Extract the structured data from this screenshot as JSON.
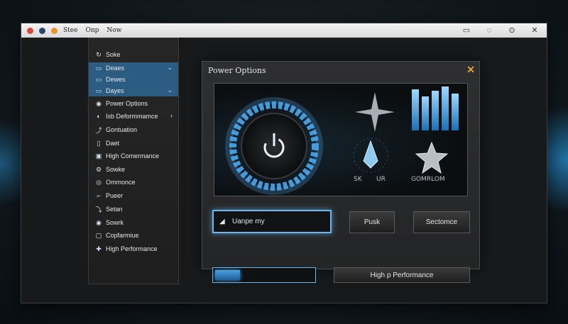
{
  "window": {
    "menu": [
      "Stee",
      "Onp",
      "Now"
    ],
    "controls": [
      "▭",
      "◌",
      "⊙",
      "✕"
    ]
  },
  "sidebar": {
    "items": [
      {
        "icon": "↻",
        "label": "Soke"
      },
      {
        "icon": "▭",
        "label": "Deaes",
        "selected": true,
        "chevron": "⌄"
      },
      {
        "icon": "▭",
        "label": "Dewes",
        "selected": true
      },
      {
        "icon": "▭",
        "label": "Dayes",
        "selected": true,
        "chevron": "⌄"
      },
      {
        "icon": "◉",
        "label": "Power Options"
      },
      {
        "icon": "◐",
        "label": "Isb Deformmamce",
        "chevron": "›"
      },
      {
        "icon": "⤴",
        "label": "Gontuation"
      },
      {
        "icon": "▯",
        "label": "Daet"
      },
      {
        "icon": "▣",
        "label": "High Comermance"
      },
      {
        "icon": "⚙",
        "label": "Sowke"
      },
      {
        "icon": "◎",
        "label": "Ommonce"
      },
      {
        "icon": "⌐",
        "label": "Pueer"
      },
      {
        "icon": "⤵",
        "label": "Setan"
      },
      {
        "icon": "◉",
        "label": "Sowrk"
      },
      {
        "icon": "▢",
        "label": "Copfarmiue"
      },
      {
        "icon": "✚",
        "label": "High Performance"
      }
    ]
  },
  "panel": {
    "title": "Power Options",
    "close": "✕",
    "visual_labels": {
      "sk": "SK",
      "ur": "UR",
      "gomrlom": "GOMRLOM"
    },
    "field_value": "Uanpe my",
    "push_label": "Pusk",
    "sectomce_label": "Sectomce",
    "performance_label": "High p Performance",
    "progress_percent": 25
  },
  "colors": {
    "accent": "#4aa0e0",
    "selected_bg": "#2c5c82",
    "close": "#e8a23c"
  }
}
